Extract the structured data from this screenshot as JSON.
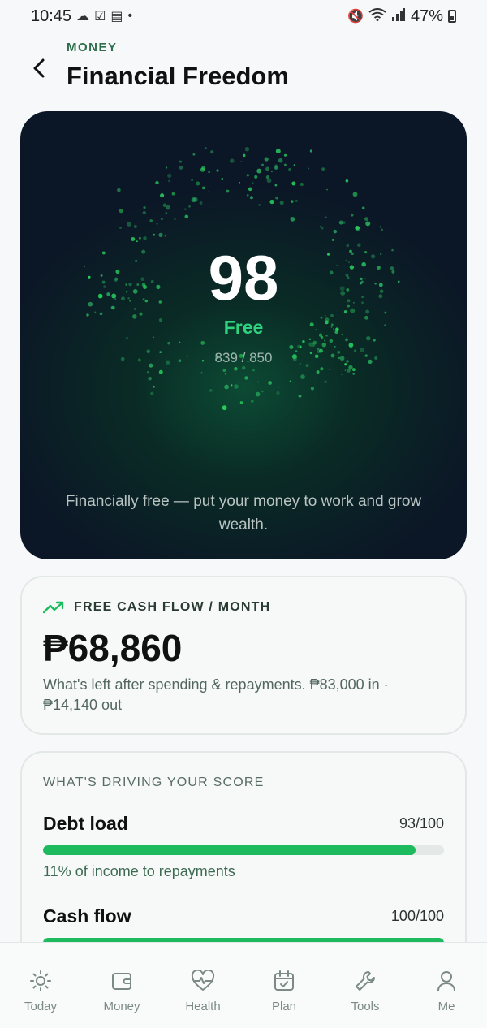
{
  "status_bar": {
    "time": "10:45",
    "battery": "47%",
    "left_icons": [
      "cloud-icon",
      "checkbox-icon",
      "calendar-icon",
      "dot-icon"
    ],
    "right_icons": [
      "mute-icon",
      "wifi-icon",
      "signal-icon",
      "battery-icon"
    ]
  },
  "header": {
    "eyebrow": "MONEY",
    "title": "Financial Freedom"
  },
  "hero": {
    "score": "98",
    "label": "Free",
    "fraction": "839 / 850",
    "description": "Financially free — put your money to work and grow wealth."
  },
  "cash_flow": {
    "icon": "trending-up-icon",
    "title": "FREE CASH FLOW / MONTH",
    "amount": "₱68,860",
    "description": "What's left after spending & repayments. ₱83,000 in · ₱14,140 out"
  },
  "drivers": {
    "title": "WHAT'S DRIVING YOUR SCORE",
    "metrics": [
      {
        "name": "Debt load",
        "score": "93/100",
        "progress": 0.93,
        "note": "11% of income to repayments"
      },
      {
        "name": "Cash flow",
        "score": "100/100",
        "progress": 1.0,
        "note": ""
      }
    ]
  },
  "nav": {
    "items": [
      {
        "label": "Today",
        "icon": "sun-icon"
      },
      {
        "label": "Money",
        "icon": "wallet-icon"
      },
      {
        "label": "Health",
        "icon": "heart-pulse-icon"
      },
      {
        "label": "Plan",
        "icon": "calendar-check-icon"
      },
      {
        "label": "Tools",
        "icon": "wrench-icon"
      },
      {
        "label": "Me",
        "icon": "person-icon"
      }
    ]
  },
  "colors": {
    "accent_green": "#1dbb5d",
    "hero_label_green": "#2fd27e",
    "eyebrow_green": "#2f6d4c",
    "hero_bg_dark": "#0b1726"
  }
}
